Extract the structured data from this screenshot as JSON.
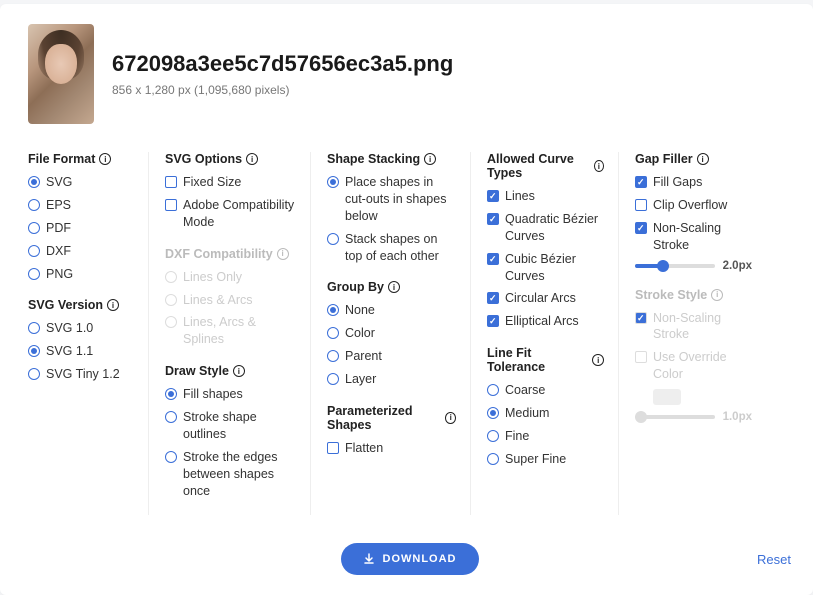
{
  "header": {
    "filename": "672098a3ee5c7d57656ec3a5.png",
    "dimensions": "856 x 1,280 px (1,095,680 pixels)"
  },
  "file_format": {
    "title": "File Format",
    "options": [
      "SVG",
      "EPS",
      "PDF",
      "DXF",
      "PNG"
    ],
    "selected": "SVG"
  },
  "svg_version": {
    "title": "SVG Version",
    "options": [
      "SVG 1.0",
      "SVG 1.1",
      "SVG Tiny 1.2"
    ],
    "selected": "SVG 1.1"
  },
  "svg_options": {
    "title": "SVG Options",
    "items": [
      {
        "label": "Fixed Size",
        "checked": false
      },
      {
        "label": "Adobe Compatibility Mode",
        "checked": false
      }
    ]
  },
  "dxf_compat": {
    "title": "DXF Compatibility",
    "options": [
      "Lines Only",
      "Lines & Arcs",
      "Lines, Arcs & Splines"
    ]
  },
  "draw_style": {
    "title": "Draw Style",
    "options": [
      "Fill shapes",
      "Stroke shape outlines",
      "Stroke the edges between shapes once"
    ],
    "selected": "Fill shapes"
  },
  "shape_stacking": {
    "title": "Shape Stacking",
    "options": [
      "Place shapes in cut-outs in shapes below",
      "Stack shapes on top of each other"
    ],
    "selected": "Place shapes in cut-outs in shapes below"
  },
  "group_by": {
    "title": "Group By",
    "options": [
      "None",
      "Color",
      "Parent",
      "Layer"
    ],
    "selected": "None"
  },
  "param_shapes": {
    "title": "Parameterized Shapes",
    "items": [
      {
        "label": "Flatten",
        "checked": false
      }
    ]
  },
  "allowed_curves": {
    "title": "Allowed Curve Types",
    "items": [
      {
        "label": "Lines",
        "checked": true
      },
      {
        "label": "Quadratic Bézier Curves",
        "checked": true
      },
      {
        "label": "Cubic Bézier Curves",
        "checked": true
      },
      {
        "label": "Circular Arcs",
        "checked": true
      },
      {
        "label": "Elliptical Arcs",
        "checked": true
      }
    ]
  },
  "line_fit": {
    "title": "Line Fit Tolerance",
    "options": [
      "Coarse",
      "Medium",
      "Fine",
      "Super Fine"
    ],
    "selected": "Medium"
  },
  "gap_filler": {
    "title": "Gap Filler",
    "items": [
      {
        "label": "Fill Gaps",
        "checked": true
      },
      {
        "label": "Clip Overflow",
        "checked": false
      },
      {
        "label": "Non-Scaling Stroke",
        "checked": true
      }
    ],
    "slider_value": "2.0px",
    "slider_pct": 35
  },
  "stroke_style": {
    "title": "Stroke Style",
    "items": [
      {
        "label": "Non-Scaling Stroke",
        "checked": true
      },
      {
        "label": "Use Override Color",
        "checked": false
      }
    ],
    "slider_value": "1.0px",
    "slider_pct": 8
  },
  "footer": {
    "download": "DOWNLOAD",
    "reset": "Reset"
  }
}
